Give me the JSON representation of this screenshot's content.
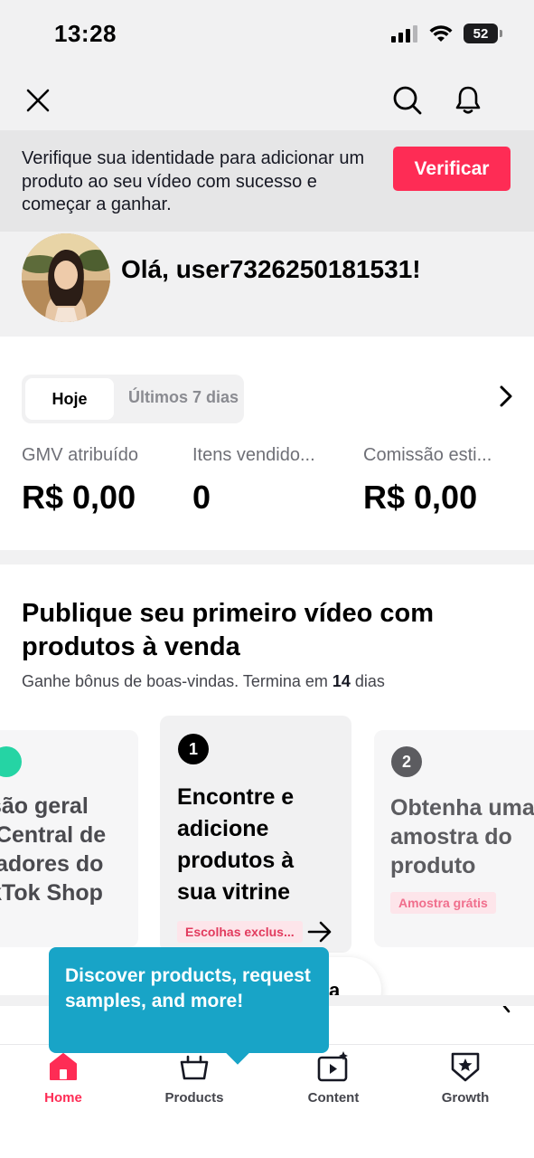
{
  "status_bar": {
    "time": "13:28",
    "battery": "52"
  },
  "top_nav": {
    "close_icon": "close-icon",
    "search_icon": "search-icon",
    "bell_icon": "bell-icon"
  },
  "verify_banner": {
    "text": "Verifique sua identidade para adicionar um produto ao seu vídeo com sucesso e começar a ganhar.",
    "button_label": "Verificar",
    "accent": "#fe2c55"
  },
  "profile": {
    "greeting": "Olá, user7326250181531!"
  },
  "stats": {
    "segments": [
      {
        "label": "Hoje",
        "active": true
      },
      {
        "label": "Últimos 7 dias",
        "active": false
      }
    ],
    "items": [
      {
        "label": "GMV atribuído",
        "value": "R$ 0,00"
      },
      {
        "label": "Itens vendido...",
        "value": "0"
      },
      {
        "label": "Comissão esti...",
        "value": "R$ 0,00"
      }
    ]
  },
  "task_section": {
    "title": "Publique seu primeiro vídeo com produtos à venda",
    "subtitle_prefix": "Ganhe bônus de boas-vindas. Termina em ",
    "subtitle_days": "14",
    "subtitle_suffix": " dias",
    "cards": [
      {
        "text": "são geral\n Central de\niadores do\nkTok Shop",
        "num_color": "#25d4a4"
      },
      {
        "number": "1",
        "text": "Encontre e\nadicione\nprodutos à\nsua vitrine",
        "tag": "Escolhas exclus...",
        "num_color": "#000000"
      },
      {
        "number": "2",
        "text": "Obtenha uma\namostra do\nproduto",
        "tag": "Amostra grátis",
        "num_color": "#5c5c60"
      }
    ],
    "pill_label": "a"
  },
  "tooltip": {
    "text": "Discover products, request samples, and more!",
    "color": "#18a4c7"
  },
  "tab_bar": {
    "tabs": [
      {
        "label": "Home",
        "icon": "home-icon",
        "active": true
      },
      {
        "label": "Products",
        "icon": "basket-icon",
        "active": false
      },
      {
        "label": "Content",
        "icon": "video-star-icon",
        "active": false
      },
      {
        "label": "Growth",
        "icon": "star-badge-icon",
        "active": false
      }
    ]
  }
}
